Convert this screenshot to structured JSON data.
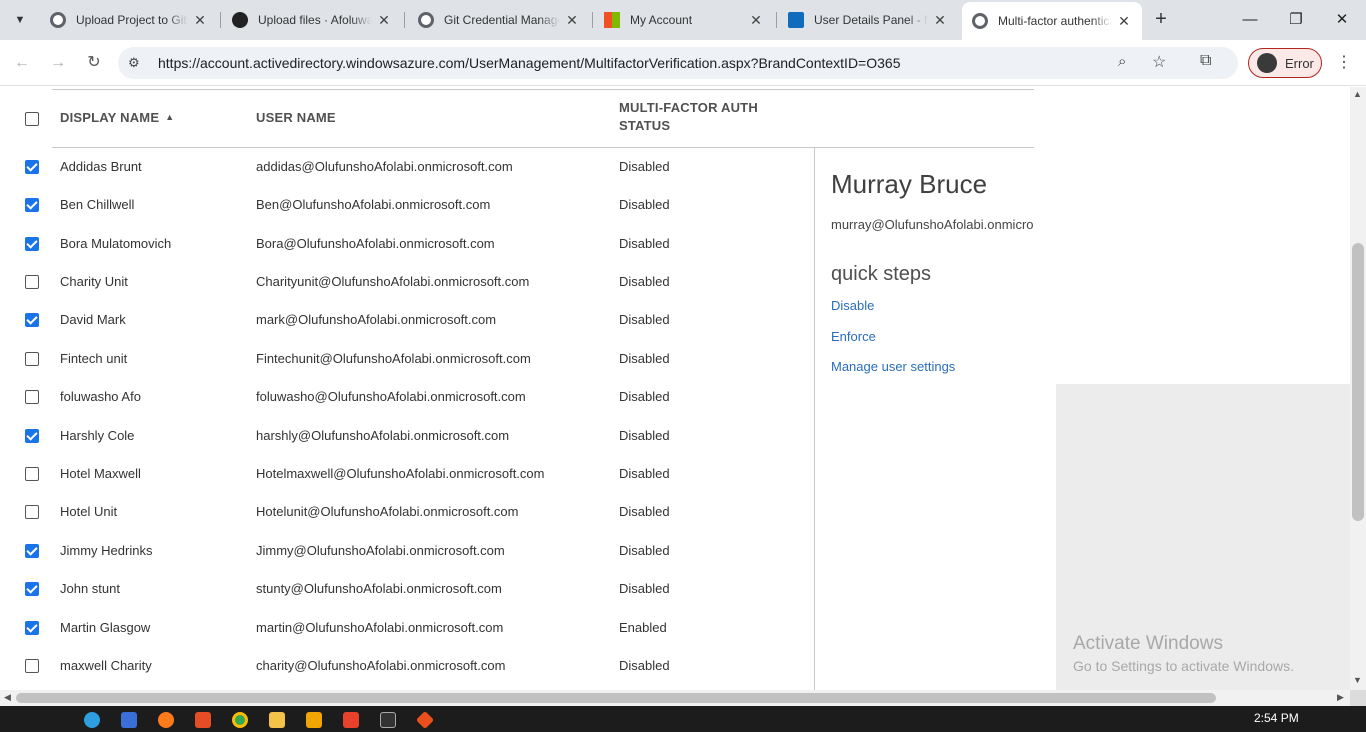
{
  "browser": {
    "tabs": [
      {
        "title": "Upload Project to GitHub",
        "active": false
      },
      {
        "title": "Upload files · Afoluwasho",
        "active": false
      },
      {
        "title": "Git Credential Manager",
        "active": false
      },
      {
        "title": "My Account",
        "active": false
      },
      {
        "title": "User Details Panel - Microsoft",
        "active": false
      },
      {
        "title": "Multi-factor authentication",
        "active": true
      }
    ],
    "url": "https://account.activedirectory.windowsazure.com/UserManagement/MultifactorVerification.aspx?BrandContextID=O365",
    "profile_label": "Error"
  },
  "table": {
    "headers": {
      "display_name": "DISPLAY NAME",
      "user_name": "USER NAME",
      "mfa_status": "MULTI-FACTOR AUTH STATUS"
    },
    "rows": [
      {
        "checked": true,
        "display_name": "Addidas Brunt",
        "user_name": "addidas@OlufunshoAfolabi.onmicrosoft.com",
        "status": "Disabled"
      },
      {
        "checked": true,
        "display_name": "Ben Chillwell",
        "user_name": "Ben@OlufunshoAfolabi.onmicrosoft.com",
        "status": "Disabled"
      },
      {
        "checked": true,
        "display_name": "Bora Mulatomovich",
        "user_name": "Bora@OlufunshoAfolabi.onmicrosoft.com",
        "status": "Disabled"
      },
      {
        "checked": false,
        "display_name": "Charity Unit",
        "user_name": "Charityunit@OlufunshoAfolabi.onmicrosoft.com",
        "status": "Disabled"
      },
      {
        "checked": true,
        "display_name": "David Mark",
        "user_name": "mark@OlufunshoAfolabi.onmicrosoft.com",
        "status": "Disabled"
      },
      {
        "checked": false,
        "display_name": "Fintech unit",
        "user_name": "Fintechunit@OlufunshoAfolabi.onmicrosoft.com",
        "status": "Disabled"
      },
      {
        "checked": false,
        "display_name": "foluwasho Afo",
        "user_name": "foluwasho@OlufunshoAfolabi.onmicrosoft.com",
        "status": "Disabled"
      },
      {
        "checked": true,
        "display_name": "Harshly Cole",
        "user_name": "harshly@OlufunshoAfolabi.onmicrosoft.com",
        "status": "Disabled"
      },
      {
        "checked": false,
        "display_name": "Hotel Maxwell",
        "user_name": "Hotelmaxwell@OlufunshoAfolabi.onmicrosoft.com",
        "status": "Disabled"
      },
      {
        "checked": false,
        "display_name": "Hotel Unit",
        "user_name": "Hotelunit@OlufunshoAfolabi.onmicrosoft.com",
        "status": "Disabled"
      },
      {
        "checked": true,
        "display_name": "Jimmy Hedrinks",
        "user_name": "Jimmy@OlufunshoAfolabi.onmicrosoft.com",
        "status": "Disabled"
      },
      {
        "checked": true,
        "display_name": "John stunt",
        "user_name": "stunty@OlufunshoAfolabi.onmicrosoft.com",
        "status": "Disabled"
      },
      {
        "checked": true,
        "display_name": "Martin Glasgow",
        "user_name": "martin@OlufunshoAfolabi.onmicrosoft.com",
        "status": "Enabled"
      },
      {
        "checked": false,
        "display_name": "maxwell Charity",
        "user_name": "charity@OlufunshoAfolabi.onmicrosoft.com",
        "status": "Disabled"
      }
    ]
  },
  "details": {
    "name": "Murray Bruce",
    "email": "murray@OlufunshoAfolabi.onmicrosoft.com",
    "quick_steps_title": "quick steps",
    "actions": [
      "Disable",
      "Enforce",
      "Manage user settings"
    ]
  },
  "watermark": {
    "line1": "Activate Windows",
    "line2": "Go to Settings to activate Windows."
  },
  "taskbar": {
    "time": "2:54 PM"
  },
  "colors": {
    "checkbox_checked": "#1a73e8",
    "link": "#2a6ebb",
    "profile_error_border": "#b3261e"
  }
}
